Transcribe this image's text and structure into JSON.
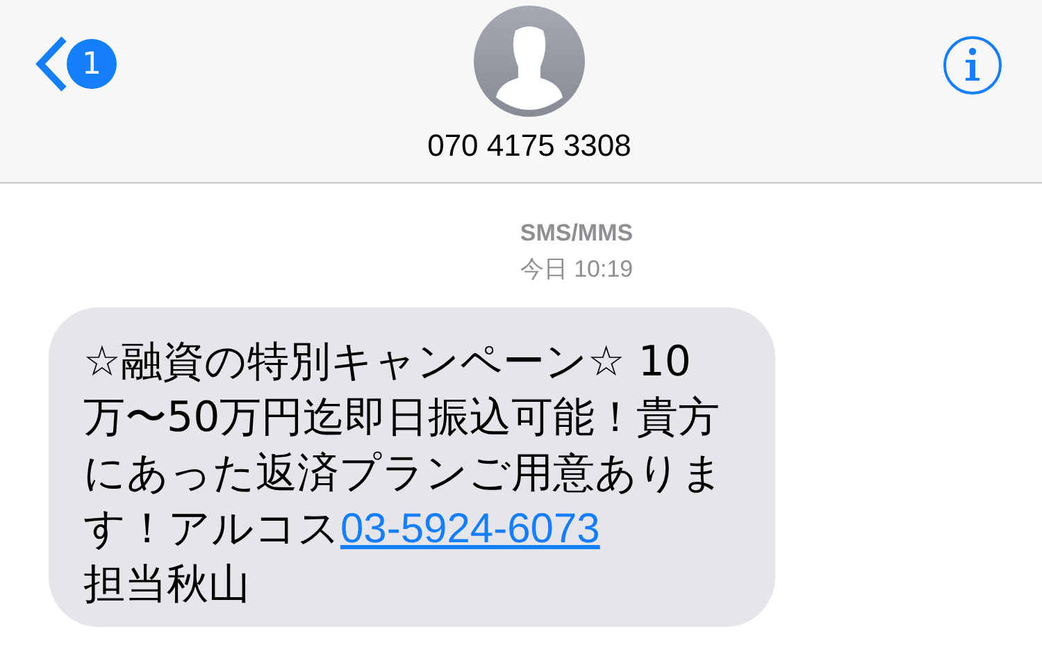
{
  "header": {
    "back_badge": "1",
    "contact": "070 4175 3308"
  },
  "thread": {
    "service": "SMS/MMS",
    "time": "今日 10:19"
  },
  "messages": [
    {
      "kind": "incoming",
      "text_before": "☆融資の特別キャンペーン☆ 10万〜50万円迄即日振込可能！貴方にあった返済プランご用意あります！アルコス",
      "link": "03-5924-6073",
      "text_after": "担当秋山"
    }
  ]
}
